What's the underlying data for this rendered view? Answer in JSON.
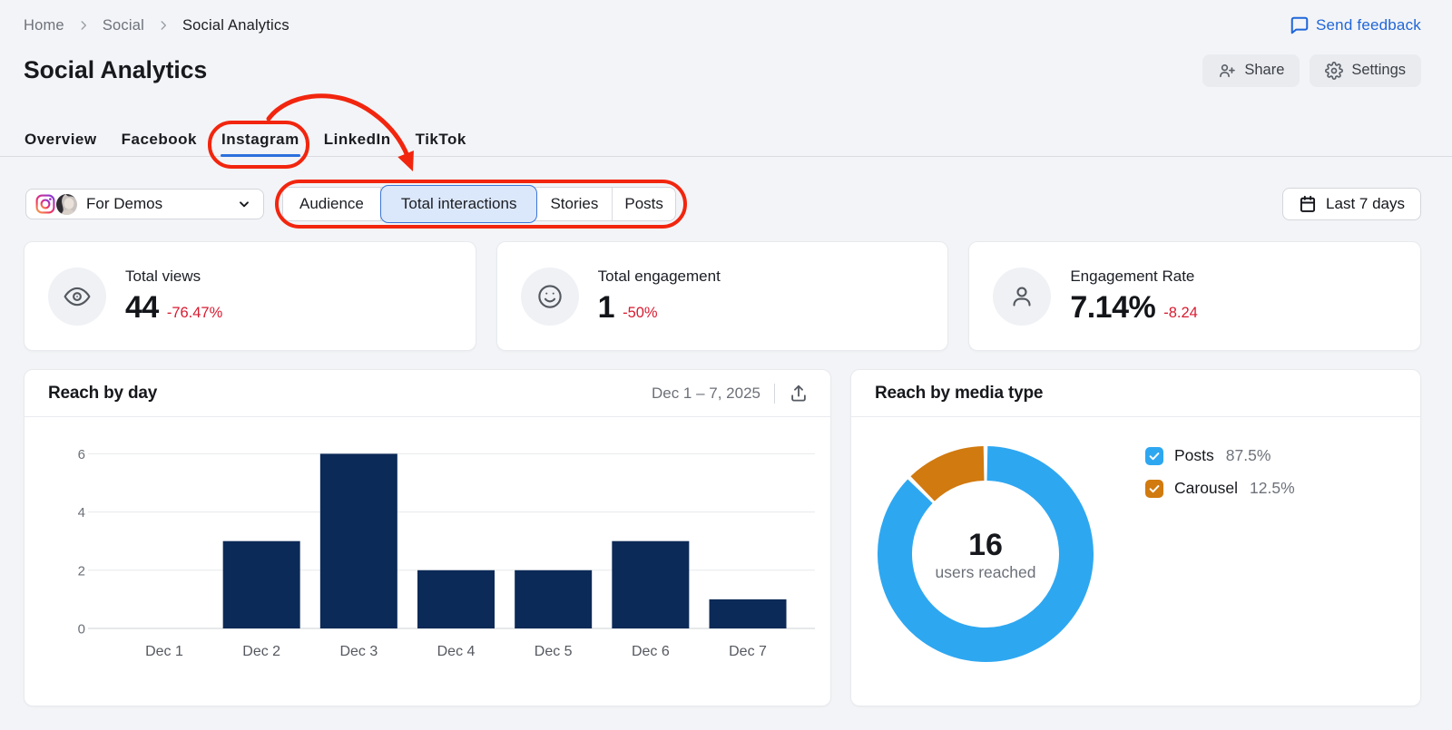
{
  "colors": {
    "annotation_red": "#f2250e",
    "accent_blue": "#2b6fdc",
    "negative_red": "#d91b30",
    "bar_navy": "#0c2a57",
    "donut_blue": "#2ea7f1",
    "donut_orange": "#d17a0f"
  },
  "breadcrumb": {
    "items": [
      "Home",
      "Social",
      "Social Analytics"
    ]
  },
  "feedback": {
    "label": "Send feedback",
    "icon": "speech-bubble-icon"
  },
  "header": {
    "title": "Social Analytics",
    "share_label": "Share",
    "settings_label": "Settings"
  },
  "tabs": [
    {
      "label": "Overview",
      "active": false
    },
    {
      "label": "Facebook",
      "active": false
    },
    {
      "label": "Instagram",
      "active": true
    },
    {
      "label": "LinkedIn",
      "active": false
    },
    {
      "label": "TikTok",
      "active": false
    }
  ],
  "controls": {
    "profile_label": "For Demos",
    "segments": [
      {
        "label": "Audience",
        "selected": false
      },
      {
        "label": "Total interactions",
        "selected": true
      },
      {
        "label": "Stories",
        "selected": false
      },
      {
        "label": "Posts",
        "selected": false
      }
    ],
    "date_range_label": "Last 7 days"
  },
  "metrics": [
    {
      "icon": "eye-icon",
      "title": "Total views",
      "value": "44",
      "change": "-76.47%"
    },
    {
      "icon": "smiley-icon",
      "title": "Total engagement",
      "value": "1",
      "change": "-50%"
    },
    {
      "icon": "person-icon",
      "title": "Engagement Rate",
      "value": "7.14%",
      "change": "-8.24"
    }
  ],
  "chart_data": [
    {
      "type": "bar",
      "title": "Reach by day",
      "date_range": "Dec 1 – 7, 2025",
      "categories": [
        "Dec 1",
        "Dec 2",
        "Dec 3",
        "Dec 4",
        "Dec 5",
        "Dec 6",
        "Dec 7"
      ],
      "values": [
        0,
        3,
        6,
        2,
        2,
        3,
        1
      ],
      "ylim": [
        0,
        6
      ],
      "yticks": [
        0,
        2,
        4,
        6
      ],
      "grid": true,
      "bar_color": "#0c2a57"
    },
    {
      "type": "donut",
      "title": "Reach by media type",
      "center_value": "16",
      "center_label": "users reached",
      "legend_position": "right",
      "segments": [
        {
          "label": "Posts",
          "value": 87.5,
          "display": "87.5%",
          "color": "#2ea7f1",
          "checked": true
        },
        {
          "label": "Carousel",
          "value": 12.5,
          "display": "12.5%",
          "color": "#d17a0f",
          "checked": true
        }
      ]
    }
  ]
}
